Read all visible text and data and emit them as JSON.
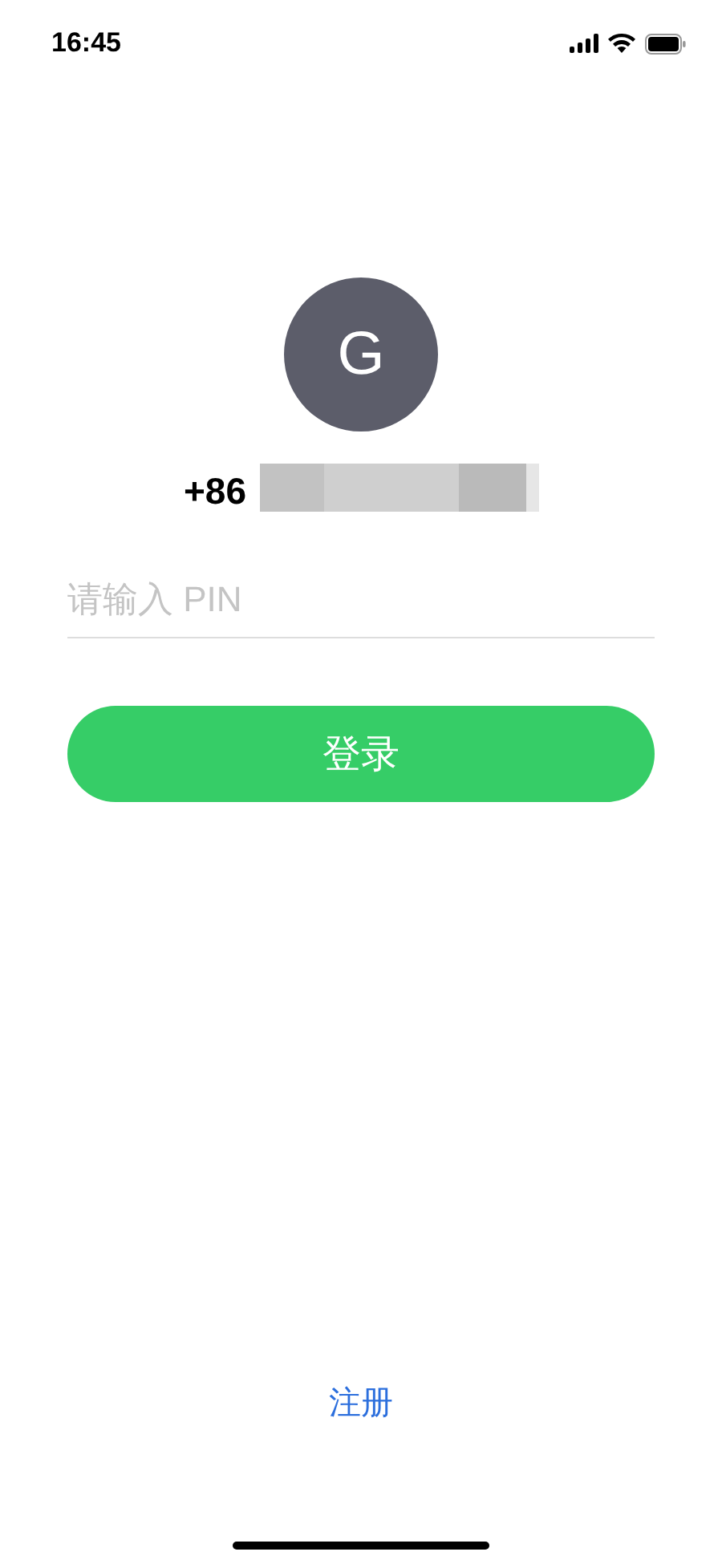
{
  "status_bar": {
    "time": "16:45"
  },
  "avatar": {
    "initial": "G"
  },
  "phone": {
    "prefix": "+86",
    "redacted": true
  },
  "pin_field": {
    "placeholder": "请输入 PIN"
  },
  "login_button": {
    "label": "登录"
  },
  "register_link": {
    "label": "注册"
  }
}
